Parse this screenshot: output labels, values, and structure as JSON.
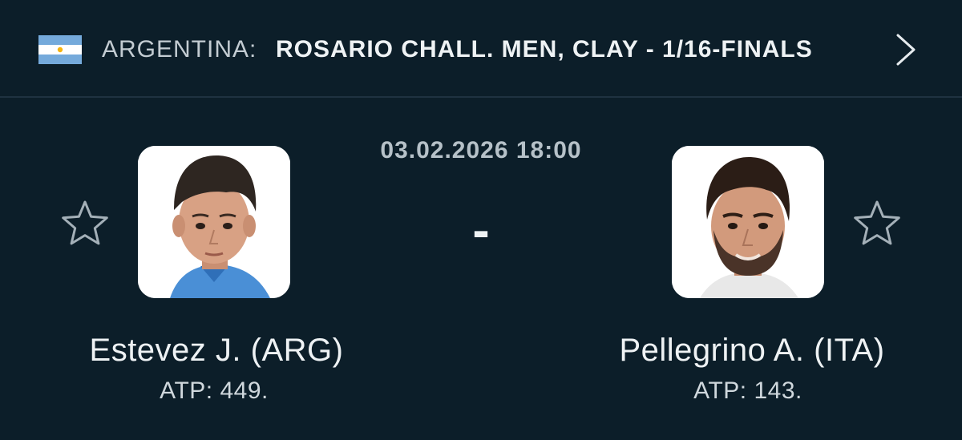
{
  "header": {
    "country": "ARGENTINA:",
    "tournament": "ROSARIO CHALL. MEN, CLAY - 1/16-FINALS",
    "flag_icon": "argentina-flag-icon",
    "next_icon": "chevron-right-icon"
  },
  "match": {
    "datetime": "03.02.2026 18:00",
    "score": "-"
  },
  "home": {
    "name": "Estevez J. (ARG)",
    "rank": "ATP: 449.",
    "favorite_icon": "star-outline-icon"
  },
  "away": {
    "name": "Pellegrino A. (ITA)",
    "rank": "ATP: 143.",
    "favorite_icon": "star-outline-icon"
  },
  "colors": {
    "background": "#0c1e29",
    "divider": "#1f3240",
    "text_primary": "#eef2f4",
    "text_muted": "#b6c1c8",
    "flag_blue": "#75aadb"
  }
}
